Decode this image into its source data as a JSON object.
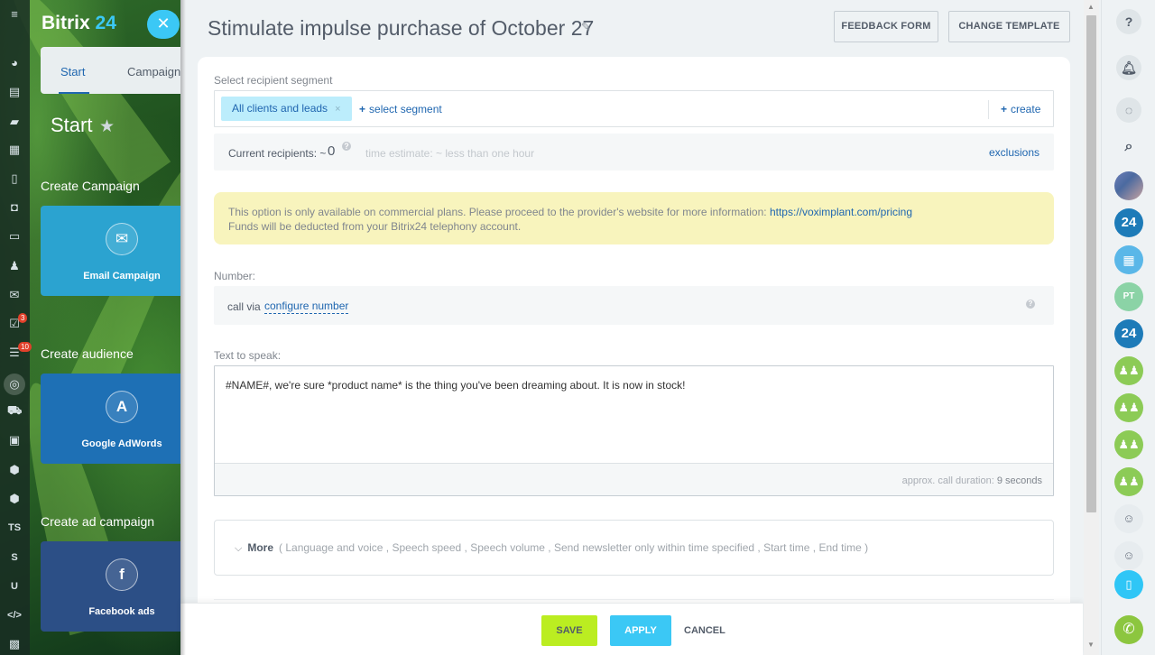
{
  "app": {
    "logo_main": "Bitrix",
    "logo_num": " 24",
    "close_icon": "close-icon",
    "tabs": [
      "Start",
      "Campaign"
    ],
    "heading": "Start",
    "sections": [
      {
        "title": "Create Campaign",
        "card_label": "Email Campaign",
        "icon": "email-icon",
        "glyph": "✉",
        "color": "#2ba3d0"
      },
      {
        "title": "Create audience",
        "card_label": "Google AdWords",
        "icon": "google-adwords-icon",
        "glyph": "A",
        "color": "#1e70b5"
      },
      {
        "title": "Create ad campaign",
        "card_label": "Facebook ads",
        "icon": "facebook-icon",
        "glyph": "f",
        "color": "#2c4f86"
      }
    ],
    "iconbar_letters": [
      "TS",
      "S",
      "U"
    ],
    "badges": [
      "3",
      "10"
    ]
  },
  "slider": {
    "title": "Stimulate impulse purchase of October 27",
    "feedback_button": "FEEDBACK FORM",
    "change_template_button": "CHANGE TEMPLATE",
    "segment": {
      "label": "Select recipient segment",
      "chip": "All clients and leads",
      "chip_remove": "×",
      "select_link": "select segment",
      "create_link": "create"
    },
    "recipients": {
      "label": "Current recipients: ~",
      "count": "0",
      "help": "?",
      "time_estimate": "time estimate: ~ less than one hour",
      "exclusions": "exclusions"
    },
    "warning": {
      "text": "This option is only available on commercial plans. Please proceed to the provider's website for more information:",
      "link": "https://voximplant.com/pricing",
      "line2": "Funds will be deducted from your Bitrix24 telephony account."
    },
    "number": {
      "label": "Number:",
      "call_via": "call via",
      "configure": "configure number"
    },
    "tts": {
      "label": "Text to speak:",
      "value": "#NAME#, we're sure *product name* is the thing you've been dreaming about. It is now in stock!",
      "duration_label": "approx. call duration:",
      "duration_value": "9 seconds"
    },
    "more": {
      "label": "More",
      "open": "(",
      "items": [
        "Language and voice",
        "Speech speed",
        "Speech volume",
        "Send newsletter only within time specified",
        "Start time",
        "End time"
      ],
      "close": ")"
    },
    "footer": {
      "save": "SAVE",
      "apply": "APPLY",
      "cancel": "CANCEL"
    }
  },
  "right_bar": {
    "help": "?",
    "items": [
      {
        "name": "help-icon"
      },
      {
        "name": "bell-icon"
      },
      {
        "name": "chat-icon"
      },
      {
        "name": "search-icon"
      },
      {
        "name": "user-avatar"
      },
      {
        "name": "bitrix24-avatar"
      },
      {
        "name": "calendar-avatar"
      },
      {
        "name": "pt-avatar",
        "text": "PT"
      },
      {
        "name": "bitrix24-avatar-2"
      },
      {
        "name": "group-avatar-1"
      },
      {
        "name": "group-avatar-2"
      },
      {
        "name": "group-avatar-3"
      },
      {
        "name": "group-avatar-4"
      },
      {
        "name": "person-avatar-1"
      },
      {
        "name": "person-avatar-2"
      },
      {
        "name": "mobile-icon"
      },
      {
        "name": "phone-icon"
      }
    ]
  },
  "colors": {
    "accent_blue": "#2067b0",
    "save_green": "#bbed21",
    "apply_blue": "#3bc8f5",
    "warning_bg": "#f8f4bd"
  }
}
